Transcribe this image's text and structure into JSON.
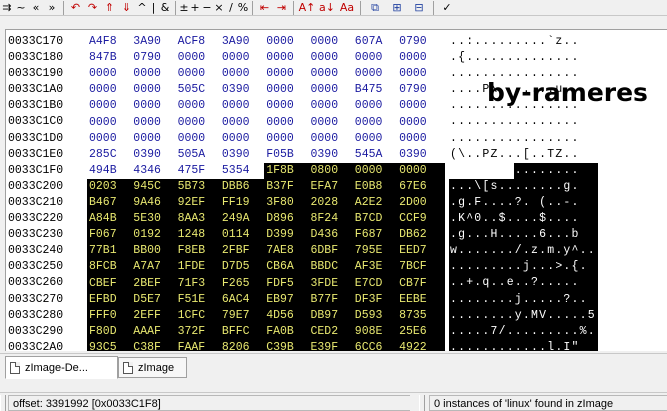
{
  "watermark": "by-rameres",
  "toolbar": {
    "icons": [
      {
        "name": "goto-forward-icon",
        "glyph": "⇉",
        "color": "#000000"
      },
      {
        "name": "tilde-icon",
        "glyph": "~",
        "color": "#000000"
      },
      {
        "name": "shift-left-icon",
        "glyph": "«",
        "color": "#000000"
      },
      {
        "name": "shift-right-icon",
        "glyph": "»",
        "color": "#000000"
      },
      {
        "name": "rotate-left-icon",
        "glyph": "↶",
        "color": "#c00000"
      },
      {
        "name": "rotate-right-icon",
        "glyph": "↷",
        "color": "#c00000"
      },
      {
        "name": "shift-up-icon",
        "glyph": "⇑",
        "color": "#c00000"
      },
      {
        "name": "shift-down-icon",
        "glyph": "⇓",
        "color": "#c00000"
      },
      {
        "name": "caret-icon",
        "glyph": "^",
        "color": "#000000"
      },
      {
        "name": "pipe-icon",
        "glyph": "|",
        "color": "#000000"
      },
      {
        "name": "ampersand-icon",
        "glyph": "&",
        "color": "#000000"
      },
      {
        "name": "sign-icon",
        "glyph": "±",
        "color": "#000000"
      },
      {
        "name": "plus-icon",
        "glyph": "+",
        "color": "#000000"
      },
      {
        "name": "minus-icon",
        "glyph": "−",
        "color": "#000000"
      },
      {
        "name": "multiply-icon",
        "glyph": "×",
        "color": "#000000"
      },
      {
        "name": "divide-icon",
        "glyph": "/",
        "color": "#000000"
      },
      {
        "name": "percent-icon",
        "glyph": "%",
        "color": "#000000"
      },
      {
        "name": "min-icon",
        "glyph": "⇤",
        "color": "#c00000"
      },
      {
        "name": "max-icon",
        "glyph": "⇥",
        "color": "#c00000"
      },
      {
        "name": "uppercase-icon",
        "glyph": "A↑",
        "color": "#c00000"
      },
      {
        "name": "lowercase-icon",
        "glyph": "a↓",
        "color": "#c00000"
      },
      {
        "name": "invert-case-icon",
        "glyph": "Aa",
        "color": "#c00000"
      },
      {
        "name": "copy-block-icon",
        "glyph": "⧉",
        "color": "#2040a0"
      },
      {
        "name": "paste-block-icon",
        "glyph": "⊞",
        "color": "#2040a0"
      },
      {
        "name": "compare-icon",
        "glyph": "⊟",
        "color": "#2040a0"
      },
      {
        "name": "hash-icon",
        "glyph": "✓",
        "color": "#000000"
      }
    ]
  },
  "hex_view": {
    "rows": [
      {
        "addr": "0033C170",
        "hex": [
          "A4F8",
          "3A90",
          "ACF8",
          "3A90",
          "0000",
          "0000",
          "607A",
          "0790"
        ],
        "ascii": "..:.........`z.."
      },
      {
        "addr": "0033C180",
        "hex": [
          "847B",
          "0790",
          "0000",
          "0000",
          "0000",
          "0000",
          "0000",
          "0000"
        ],
        "ascii": ".{.............."
      },
      {
        "addr": "0033C190",
        "hex": [
          "0000",
          "0000",
          "0000",
          "0000",
          "0000",
          "0000",
          "0000",
          "0000"
        ],
        "ascii": "................"
      },
      {
        "addr": "0033C1A0",
        "hex": [
          "0000",
          "0000",
          "505C",
          "0390",
          "0000",
          "0000",
          "B475",
          "0790"
        ],
        "ascii": "....P\\.......u.."
      },
      {
        "addr": "0033C1B0",
        "hex": [
          "0000",
          "0000",
          "0000",
          "0000",
          "0000",
          "0000",
          "0000",
          "0000"
        ],
        "ascii": "................"
      },
      {
        "addr": "0033C1C0",
        "hex": [
          "0000",
          "0000",
          "0000",
          "0000",
          "0000",
          "0000",
          "0000",
          "0000"
        ],
        "ascii": "................"
      },
      {
        "addr": "0033C1D0",
        "hex": [
          "0000",
          "0000",
          "0000",
          "0000",
          "0000",
          "0000",
          "0000",
          "0000"
        ],
        "ascii": "................"
      },
      {
        "addr": "0033C1E0",
        "hex": [
          "285C",
          "0390",
          "505A",
          "0390",
          "F05B",
          "0390",
          "545A",
          "0390"
        ],
        "ascii": "(\\..PZ...[..TZ.."
      },
      {
        "addr": "0033C1F0",
        "hex": [
          "494B",
          "4346",
          "475F",
          "5354",
          "1F8B",
          "0800",
          "0000",
          "0000"
        ],
        "ascii": "IKCFG_ST........",
        "sel_from": 4
      },
      {
        "addr": "0033C200",
        "hex": [
          "0203",
          "945C",
          "5B73",
          "DBB6",
          "B37F",
          "EFA7",
          "E0B8",
          "67E6"
        ],
        "ascii": "...\\[s........g.",
        "sel_from": 0
      },
      {
        "addr": "0033C210",
        "hex": [
          "B467",
          "9A46",
          "92EF",
          "FF19",
          "3F80",
          "2028",
          "A2E2",
          "2D00"
        ],
        "ascii": ".g.F....?. (..-.",
        "sel_from": 0
      },
      {
        "addr": "0033C220",
        "hex": [
          "A84B",
          "5E30",
          "8AA3",
          "249A",
          "D896",
          "8F24",
          "B7CD",
          "CCF9"
        ],
        "ascii": ".K^0..$....$....",
        "sel_from": 0
      },
      {
        "addr": "0033C230",
        "hex": [
          "F067",
          "0192",
          "1248",
          "0114",
          "D399",
          "D436",
          "F687",
          "DB62"
        ],
        "ascii": ".g...H.....6...b",
        "sel_from": 0
      },
      {
        "addr": "0033C240",
        "hex": [
          "77B1",
          "BB00",
          "F8EB",
          "2FBF",
          "7AE8",
          "6DBF",
          "795E",
          "EED7"
        ],
        "ascii": "w......./.z.m.y^..",
        "sel_from": 0
      },
      {
        "addr": "0033C250",
        "hex": [
          "8FCB",
          "A7A7",
          "1FDE",
          "D7D5",
          "CB6A",
          "BBDC",
          "AF3E",
          "7BCF"
        ],
        "ascii": ".........j...>.{.",
        "sel_from": 0
      },
      {
        "addr": "0033C260",
        "hex": [
          "CBEF",
          "2BEF",
          "71F3",
          "F265",
          "FDF5",
          "3FDE",
          "E7CD",
          "CB7F"
        ],
        "ascii": "..+.q..e..?.....",
        "sel_from": 0
      },
      {
        "addr": "0033C270",
        "hex": [
          "EFBD",
          "D5E7",
          "F51E",
          "6AC4",
          "EB97",
          "B77F",
          "DF3F",
          "EEBE"
        ],
        "ascii": "........j.....?..",
        "sel_from": 0
      },
      {
        "addr": "0033C280",
        "hex": [
          "FFF0",
          "2EFF",
          "1CFC",
          "79E7",
          "4D56",
          "DB97",
          "D593",
          "8735"
        ],
        "ascii": "........y.MV.....5",
        "sel_from": 0
      },
      {
        "addr": "0033C290",
        "hex": [
          "F80D",
          "AAAF",
          "372F",
          "BFFC",
          "FA0B",
          "CED2",
          "908E",
          "25E6"
        ],
        "ascii": ".....7/.........%.",
        "sel_from": 0
      },
      {
        "addr": "0033C2A0",
        "hex": [
          "93C5",
          "C38F",
          "FAAF",
          "8206",
          "C39B",
          "E39F",
          "6CC6",
          "4922"
        ],
        "ascii": "............l.I\"",
        "sel_from": 0
      }
    ]
  },
  "tabs": [
    {
      "label": "zImage-De...",
      "active": true
    },
    {
      "label": "zImage",
      "active": false
    }
  ],
  "status": {
    "offset": "offset: 3391992 [0x0033C1F8]",
    "search": "0 instances of 'linux' found in zImage"
  }
}
